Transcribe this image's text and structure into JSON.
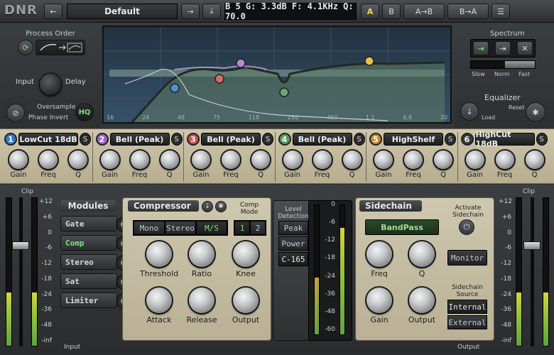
{
  "app": {
    "logo": "DNR"
  },
  "topbar": {
    "preset": "Default",
    "info": "B 5 G: 3.3dB F: 4.1KHz Q: 70.0",
    "a": "A",
    "b": "B",
    "atob": "A→B",
    "btoa": "B→A"
  },
  "left": {
    "process_order": "Process Order",
    "input": "Input",
    "delay": "Delay",
    "oversample": "Oversample",
    "phase_invert": "Phase Invert",
    "hq": "HQ"
  },
  "right": {
    "spectrum": "Spectrum",
    "slow": "Slow",
    "norm": "Norm",
    "fast": "Fast",
    "equalizer": "Equalizer",
    "load": "Load",
    "reset": "Reset"
  },
  "graph": {
    "freq_labels": [
      "16",
      "24",
      "48",
      "75",
      "118",
      "250",
      "450",
      "1.1",
      "6.8",
      "20"
    ]
  },
  "bands": [
    {
      "num": "1",
      "name": "LowCut 18dB",
      "color": "#3a78c8"
    },
    {
      "num": "2",
      "name": "Bell (Peak)",
      "color": "#9a63c8"
    },
    {
      "num": "3",
      "name": "Bell (Peak)",
      "color": "#c84f4f"
    },
    {
      "num": "4",
      "name": "Bell (Peak)",
      "color": "#5a9a58"
    },
    {
      "num": "5",
      "name": "HighShelf",
      "color": "#c88c2c"
    },
    {
      "num": "6",
      "name": "HighCut 18dB",
      "color": "#3a3a3a"
    }
  ],
  "band_knob_labels": [
    "Gain",
    "Freq",
    "Q"
  ],
  "modules": {
    "title": "Modules",
    "items": [
      "Gate",
      "Comp",
      "Stereo",
      "Sat",
      "Limiter"
    ]
  },
  "compressor": {
    "title": "Compressor",
    "comp_mode": "Comp Mode",
    "mode_buttons": [
      "Mono",
      "Stereo",
      "M/S"
    ],
    "mode_nums": [
      "1",
      "2"
    ],
    "knobs": [
      "Threshold",
      "Ratio",
      "Knee",
      "Attack",
      "Release",
      "Output"
    ]
  },
  "level": {
    "title": "Level Detection",
    "buttons": [
      "Peak",
      "Power",
      "C-165"
    ],
    "scale": [
      "0",
      "-6",
      "-12",
      "-18",
      "-24",
      "-36",
      "-48",
      "-60"
    ]
  },
  "sidechain": {
    "title": "Sidechain",
    "activate": "Activate Sidechain",
    "filter": "BandPass",
    "monitor": "Monitor",
    "source": "Sidechain Source",
    "internal": "Internal",
    "external": "External",
    "knobs": [
      "Freq",
      "Q",
      "Gain",
      "Output"
    ]
  },
  "meters": {
    "clip": "Clip",
    "scale": [
      "+12",
      "+6",
      "0",
      "-6",
      "-12",
      "-18",
      "-24",
      "-36",
      "-48",
      "-inf"
    ],
    "input": "Input",
    "output": "Output"
  }
}
